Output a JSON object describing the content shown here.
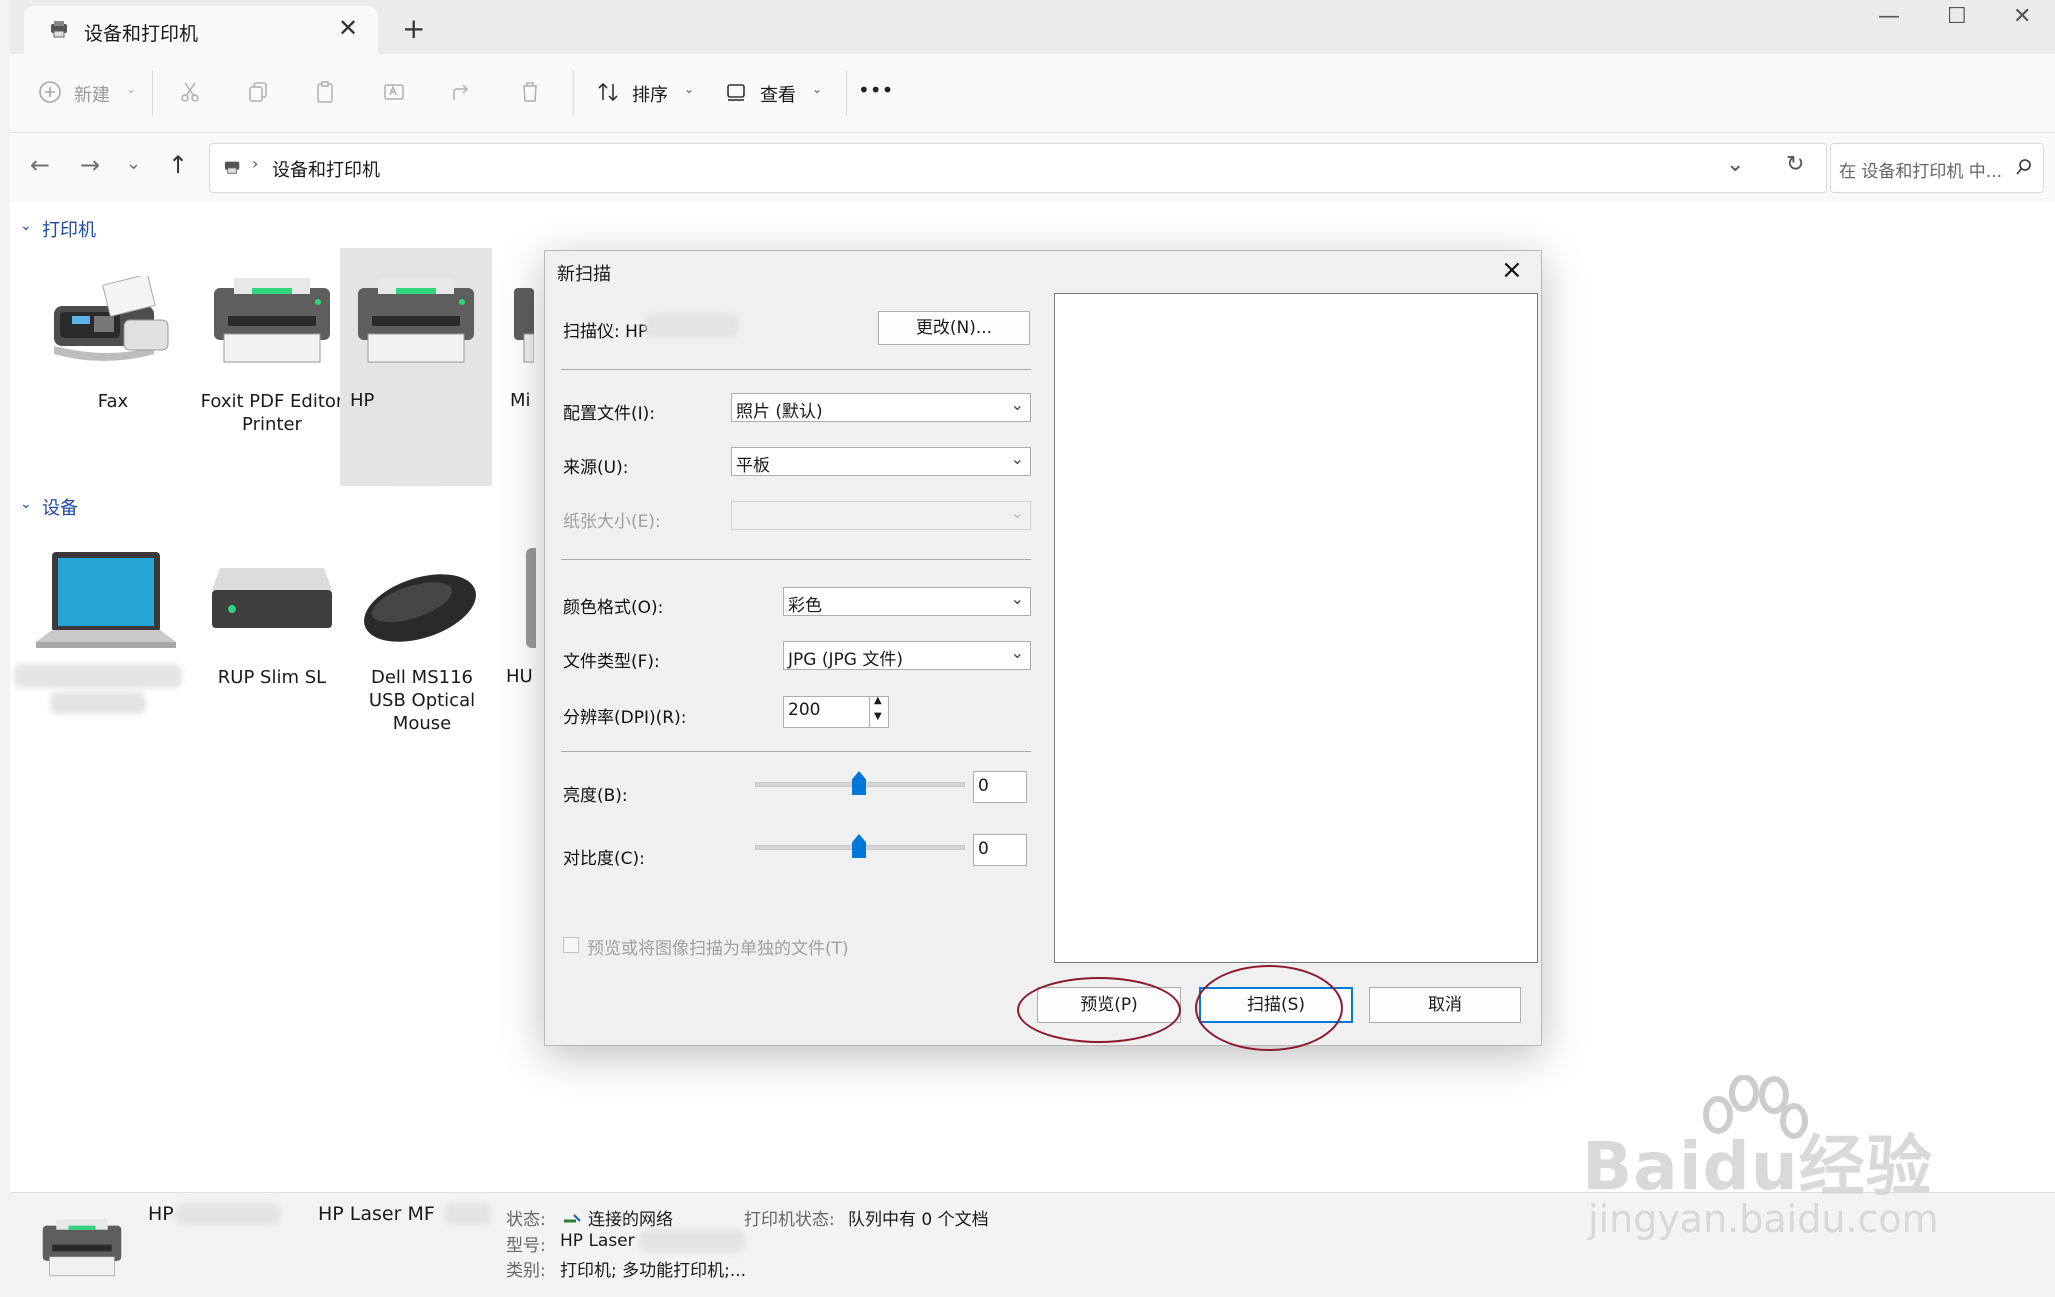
{
  "window": {
    "tab_title": "设备和打印机",
    "new_tab": "+",
    "tab_close": "✕",
    "minimize": "—",
    "maximize": "☐",
    "close": "✕"
  },
  "toolbar": {
    "new_label": "新建",
    "sort_label": "排序",
    "view_label": "查看",
    "more": "•••"
  },
  "address": {
    "path": "设备和打印机",
    "search_placeholder": "在 设备和打印机 中..."
  },
  "printers": {
    "section_label": "打印机",
    "items": [
      {
        "label": "Fax"
      },
      {
        "label": "Foxit PDF Editor Printer"
      },
      {
        "label": "HP"
      },
      {
        "label": "Mi"
      }
    ]
  },
  "devices": {
    "section_label": "设备",
    "items": [
      {
        "label": ""
      },
      {
        "label": "RUP Slim SL"
      },
      {
        "label": "Dell MS116 USB Optical Mouse"
      },
      {
        "label": "HU"
      }
    ]
  },
  "statusbar": {
    "device_name": "HP",
    "device_name_2": "HP Laser MF",
    "state_label": "状态:",
    "state_value": "连接的网络",
    "printer_state_label": "打印机状态:",
    "printer_state_value": "队列中有 0 个文档",
    "model_label": "型号:",
    "model_value": "HP Laser",
    "category_label": "类别:",
    "category_value": "打印机; 多功能打印机;..."
  },
  "dialog": {
    "title": "新扫描",
    "scanner_label": "扫描仪: HP",
    "change_button": "更改(N)...",
    "profile_label": "配置文件(I):",
    "profile_value": "照片 (默认)",
    "source_label": "来源(U):",
    "source_value": "平板",
    "paper_label": "纸张大小(E):",
    "color_label": "颜色格式(O):",
    "color_value": "彩色",
    "filetype_label": "文件类型(F):",
    "filetype_value": "JPG (JPG 文件)",
    "dpi_label": "分辨率(DPI)(R):",
    "dpi_value": "200",
    "brightness_label": "亮度(B):",
    "brightness_value": "0",
    "contrast_label": "对比度(C):",
    "contrast_value": "0",
    "separate_files_label": "预览或将图像扫描为单独的文件(T)",
    "preview_button": "预览(P)",
    "scan_button": "扫描(S)",
    "cancel_button": "取消"
  },
  "watermark": {
    "brand": "Baidu经验",
    "url": "jingyan.baidu.com"
  }
}
